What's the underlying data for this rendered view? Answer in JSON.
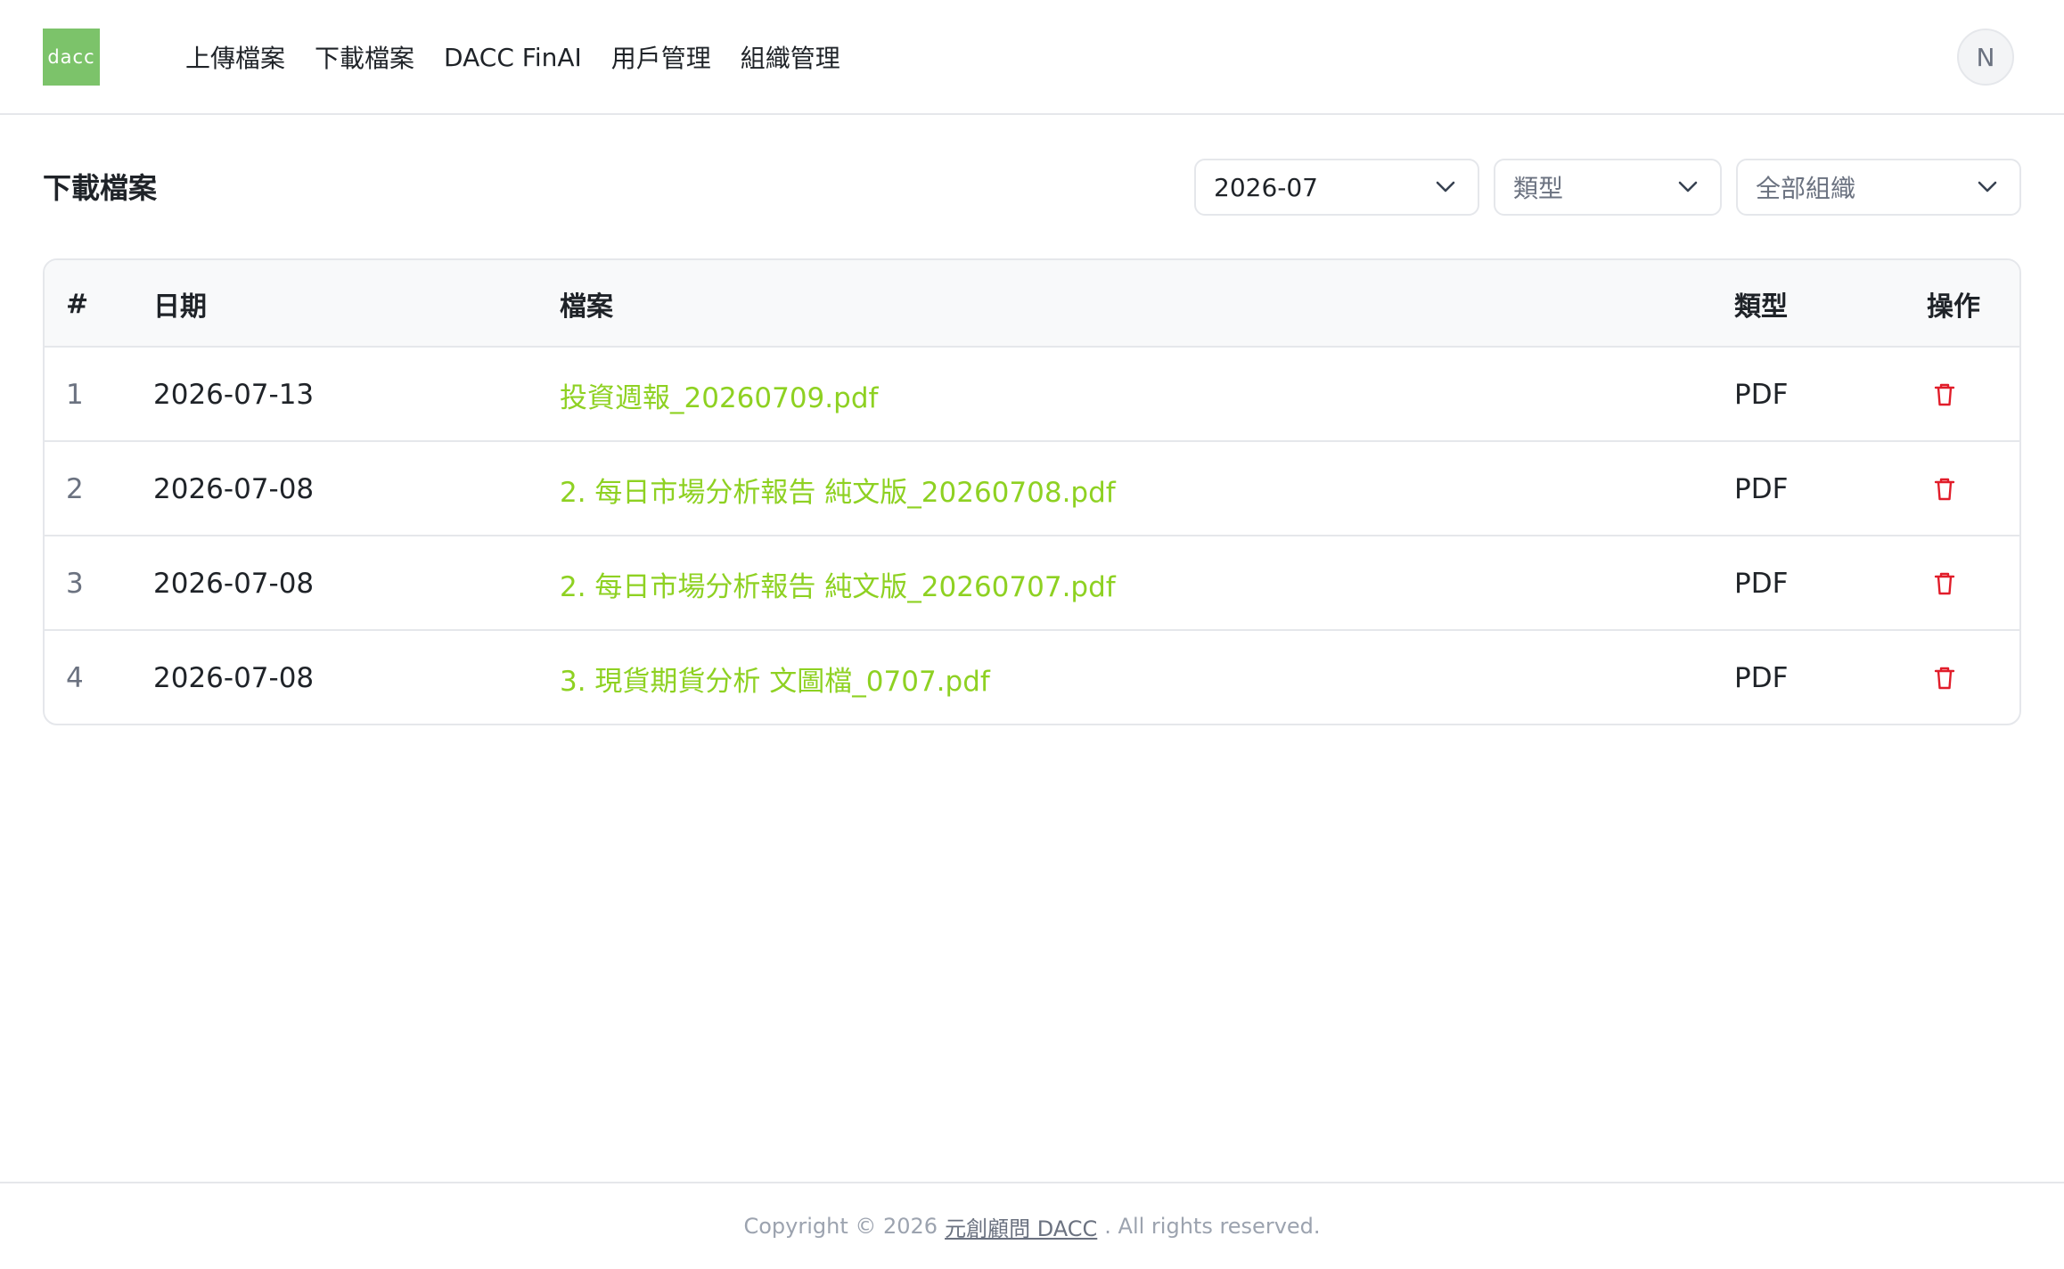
{
  "header": {
    "logo_text": "dacc",
    "nav": [
      "上傳檔案",
      "下載檔案",
      "DACC FinAI",
      "用戶管理",
      "組織管理"
    ],
    "avatar_initial": "N"
  },
  "page": {
    "title": "下載檔案"
  },
  "filters": {
    "month": "2026-07",
    "type_placeholder": "類型",
    "org_placeholder": "全部組織"
  },
  "table": {
    "columns": [
      "#",
      "日期",
      "檔案",
      "類型",
      "操作"
    ],
    "rows": [
      {
        "index": "1",
        "date": "2026-07-13",
        "file": "投資週報_20260709.pdf",
        "type": "PDF"
      },
      {
        "index": "2",
        "date": "2026-07-08",
        "file": "2. 每日市場分析報告 純文版_20260708.pdf",
        "type": "PDF"
      },
      {
        "index": "3",
        "date": "2026-07-08",
        "file": "2. 每日市場分析報告 純文版_20260707.pdf",
        "type": "PDF"
      },
      {
        "index": "4",
        "date": "2026-07-08",
        "file": "3. 現貨期貨分析 文圖檔_0707.pdf",
        "type": "PDF"
      }
    ]
  },
  "footer": {
    "prefix": "Copyright © 2026",
    "link": "元創顧問 DACC",
    "suffix": ". All rights reserved."
  },
  "colors": {
    "accent_green": "#8ed122",
    "logo_green": "#7cc36a",
    "delete_red": "#e11d2a"
  },
  "icons": {
    "delete": "trash-icon",
    "dropdown": "chevron-down-icon"
  }
}
